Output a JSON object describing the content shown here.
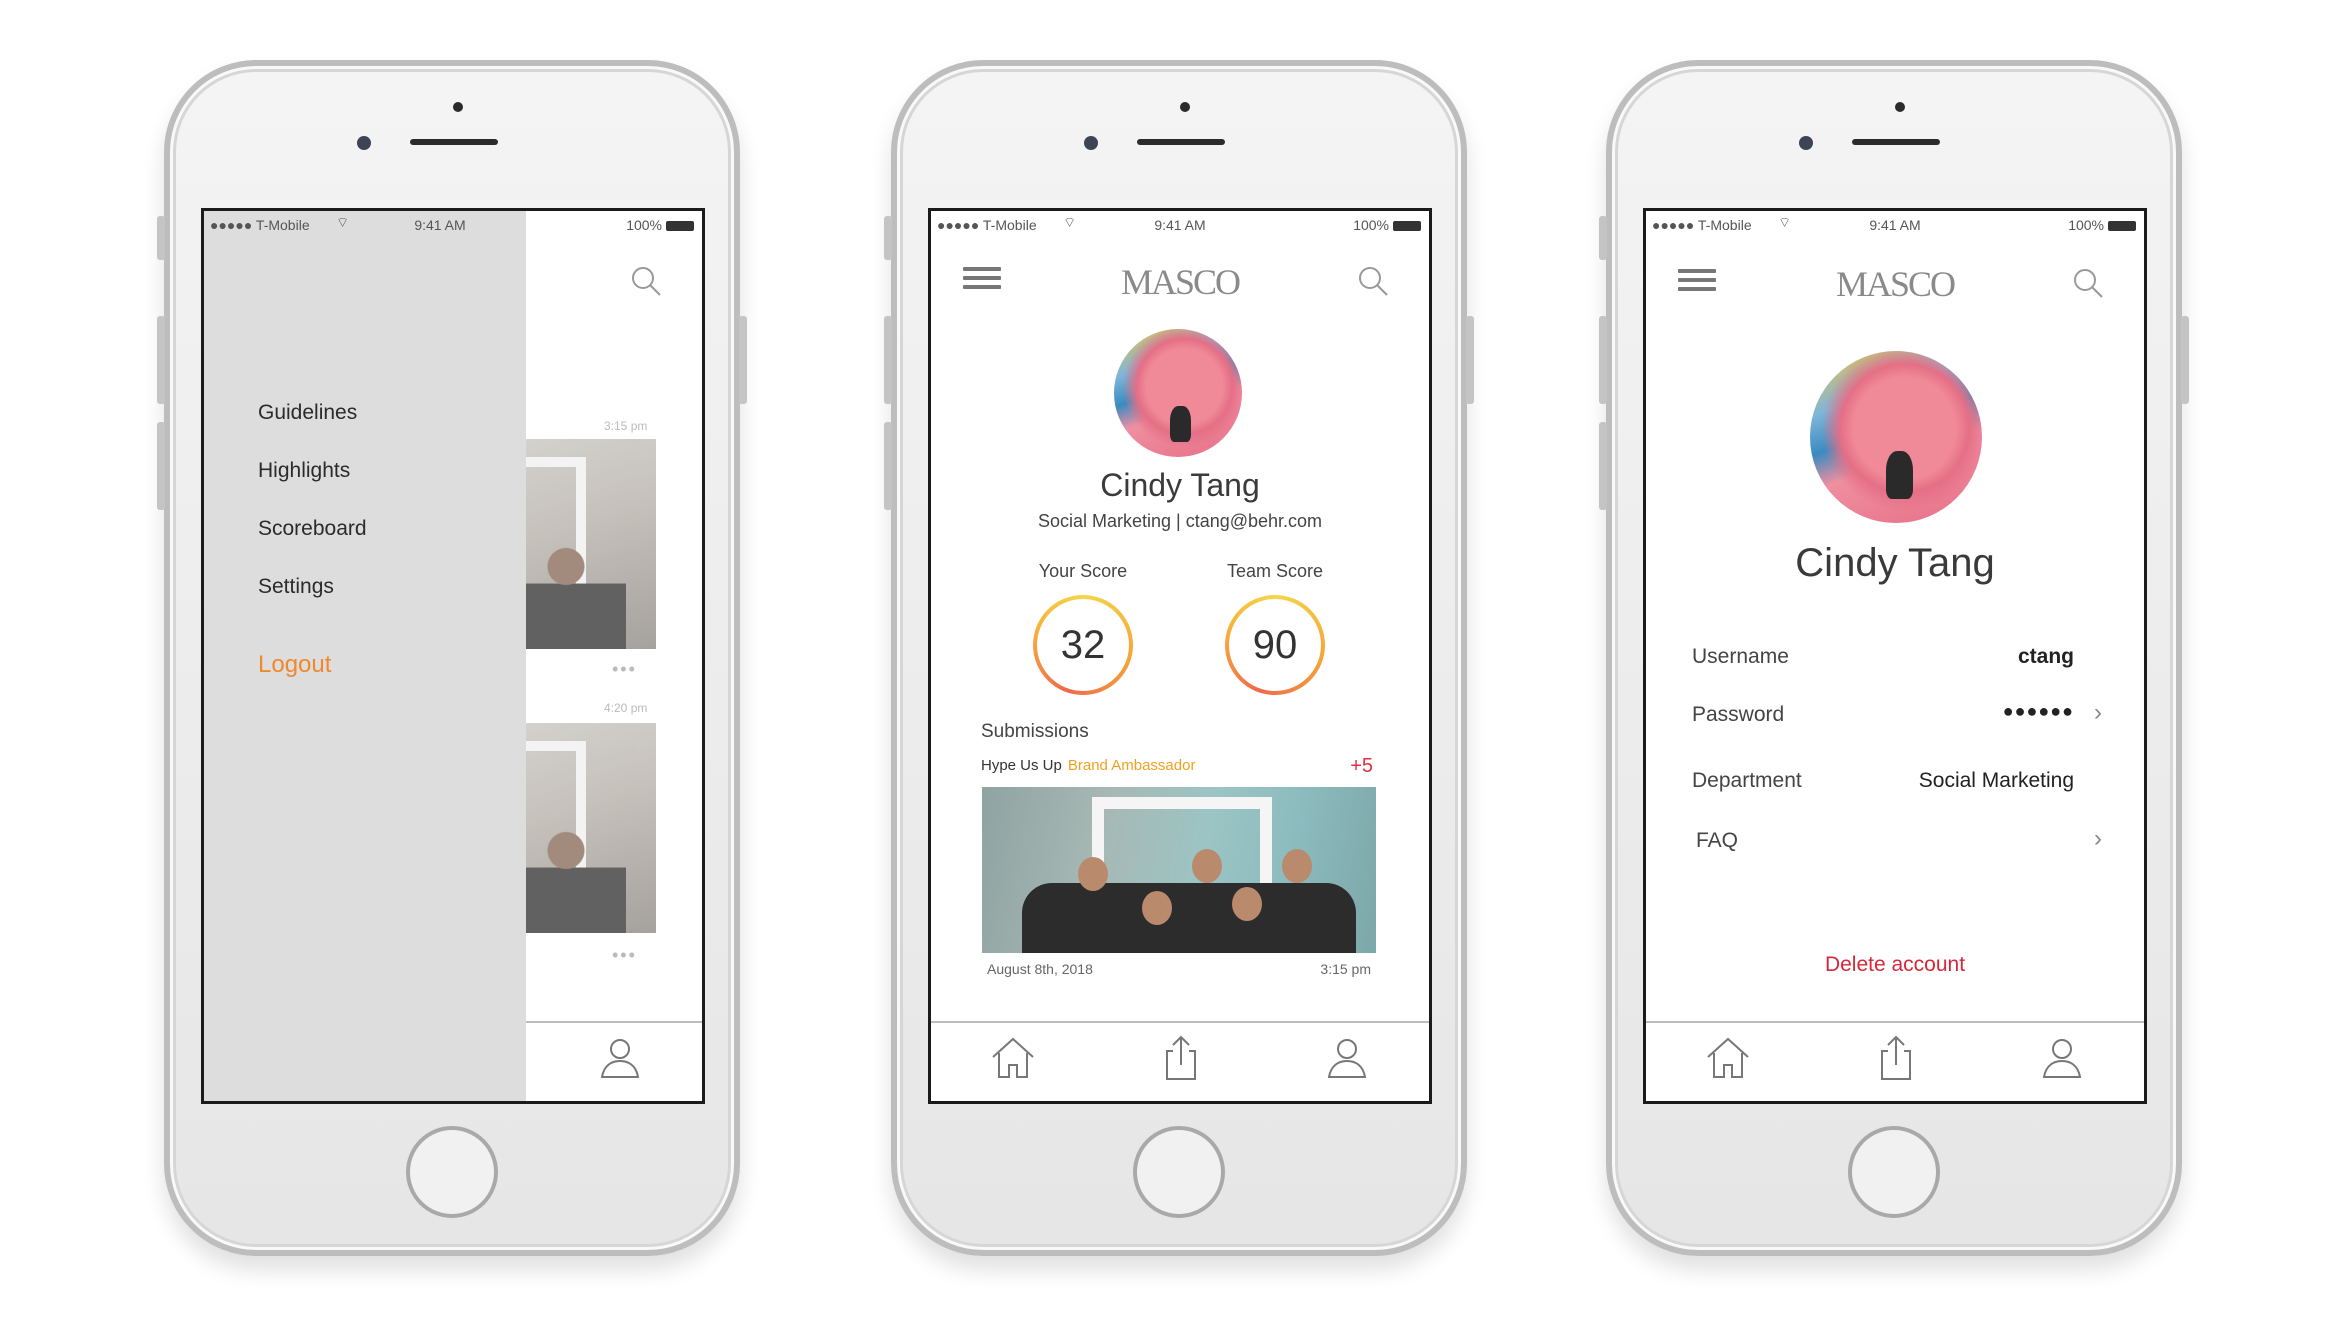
{
  "status_bar": {
    "carrier": "●●●●● T-Mobile",
    "time": "9:41 AM",
    "battery": "100%"
  },
  "brand": {
    "logo": "MASCO"
  },
  "phone1": {
    "menu": {
      "items": [
        "Guidelines",
        "Highlights",
        "Scoreboard",
        "Settings"
      ],
      "logout": "Logout"
    },
    "feed": {
      "time1": "3:15 pm",
      "time2": "4:20 pm",
      "more": "•••"
    }
  },
  "phone2": {
    "name": "Cindy Tang",
    "subline": "Social Marketing | ctang@behr.com",
    "your_score_label": "Your Score",
    "your_score": "32",
    "team_score_label": "Team Score",
    "team_score": "90",
    "submissions_heading": "Submissions",
    "submission": {
      "title": "Hype Us Up",
      "tag": "Brand Ambassador",
      "points": "+5",
      "date": "August 8th, 2018",
      "time": "3:15 pm"
    }
  },
  "phone3": {
    "name": "Cindy Tang",
    "rows": [
      {
        "label": "Username",
        "value": "ctang"
      },
      {
        "label": "Password",
        "value": "●●●●●●"
      },
      {
        "label": "Department",
        "value": "Social Marketing"
      },
      {
        "label": "FAQ",
        "value": ""
      }
    ],
    "delete_label": "Delete account"
  },
  "icons": {
    "menu": "hamburger-icon",
    "search": "search-icon",
    "home": "home-icon",
    "share": "share-icon",
    "profile": "profile-icon",
    "chevron": "chevron-right-icon"
  },
  "colors": {
    "accent_orange": "#f0882c",
    "points_red": "#e0303f",
    "delete_red": "#d7283b",
    "tag_orange": "#f1a120"
  }
}
